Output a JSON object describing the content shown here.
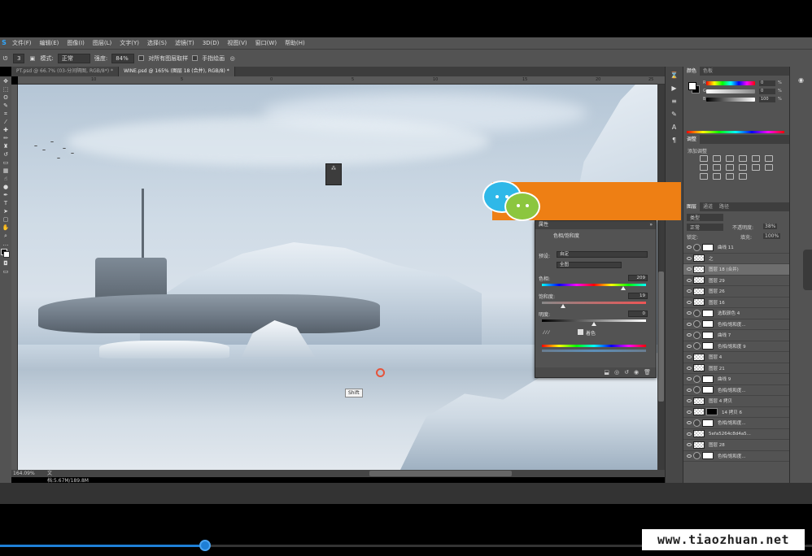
{
  "app": {
    "logo": "S"
  },
  "menu": [
    "文件(F)",
    "编辑(E)",
    "图像(I)",
    "图层(L)",
    "文字(Y)",
    "选择(S)",
    "滤镜(T)",
    "3D(D)",
    "视图(V)",
    "窗口(W)",
    "帮助(H)"
  ],
  "options": {
    "mode_label": "模式:",
    "mode_value": "正常",
    "opacity_label": "强度:",
    "opacity_value": "84%",
    "sample_all": "对所有图层取样",
    "finger": "手指绘画"
  },
  "tabs": [
    {
      "label": "PT.psd @ 66.7% (03-分间隔图, RGB/8*) *",
      "active": false
    },
    {
      "label": "WINE.psd @ 165% (图层 18 (合并), RGB/8) *",
      "active": true
    }
  ],
  "ruler_ticks": [
    "10",
    "5",
    "0",
    "5",
    "10",
    "15",
    "20",
    "25"
  ],
  "canvas": {
    "hud_card": "⁂",
    "shift_tooltip": "Shift"
  },
  "status": {
    "zoom": "164.09%",
    "doc": "文档:5.67M/189.8M"
  },
  "panels": {
    "color_tabs": [
      "颜色",
      "色板"
    ],
    "color_labels": {
      "r": "R",
      "g": "G",
      "b": "B"
    },
    "color_values": {
      "r": "0",
      "g": "0",
      "b": "100"
    },
    "color_units": {
      "r": "%",
      "g": "%",
      "b": "%"
    },
    "adjust_tabs": [
      "调整"
    ],
    "adjust_label": "添加调整",
    "layer_tabs": [
      "图层",
      "通道",
      "路径"
    ],
    "layer_kind": "类型",
    "blend_mode": "正常",
    "opacity_label": "不透明度:",
    "opacity_value": "38%",
    "lock_label": "锁定:",
    "fill_label": "填充:",
    "fill_value": "100%"
  },
  "layers": [
    {
      "name": "曲线 11",
      "type": "adj"
    },
    {
      "name": "之",
      "type": "layer"
    },
    {
      "name": "图层 18 (合并)",
      "type": "layer",
      "selected": true
    },
    {
      "name": "图层 29",
      "type": "layer"
    },
    {
      "name": "图层 26",
      "type": "layer"
    },
    {
      "name": "图层 16",
      "type": "layer"
    },
    {
      "name": "选取颜色 4",
      "type": "adj"
    },
    {
      "name": "色相/饱和度...",
      "type": "adj"
    },
    {
      "name": "曲线 7",
      "type": "adj"
    },
    {
      "name": "色相/饱和度 9",
      "type": "adj"
    },
    {
      "name": "图层 4",
      "type": "layer"
    },
    {
      "name": "图层 21",
      "type": "layer"
    },
    {
      "name": "曲线 9",
      "type": "adj"
    },
    {
      "name": "色相/饱和度...",
      "type": "adj"
    },
    {
      "name": "图层 4 拷贝",
      "type": "layer"
    },
    {
      "name": "14 拷贝 6",
      "type": "black"
    },
    {
      "name": "色相/饱和度...",
      "type": "adj"
    },
    {
      "name": "5efa5264c8d4a5...",
      "type": "layer"
    },
    {
      "name": "图层 28",
      "type": "layer"
    },
    {
      "name": "色相/饱和度...",
      "type": "adj"
    }
  ],
  "properties": {
    "title": "属性",
    "subtitle": "色相/饱和度",
    "preset_label": "预设:",
    "preset_value": "自定",
    "channel_value": "全图",
    "hue_label": "色相:",
    "hue_value": "209",
    "hue_position": 0.78,
    "sat_label": "饱和度:",
    "sat_value": "19",
    "sat_position": 0.2,
    "light_label": "明度:",
    "light_value": "0",
    "light_position": 0.5,
    "colorize_label": "着色"
  },
  "watermark": "www.tiaozhuan.net"
}
